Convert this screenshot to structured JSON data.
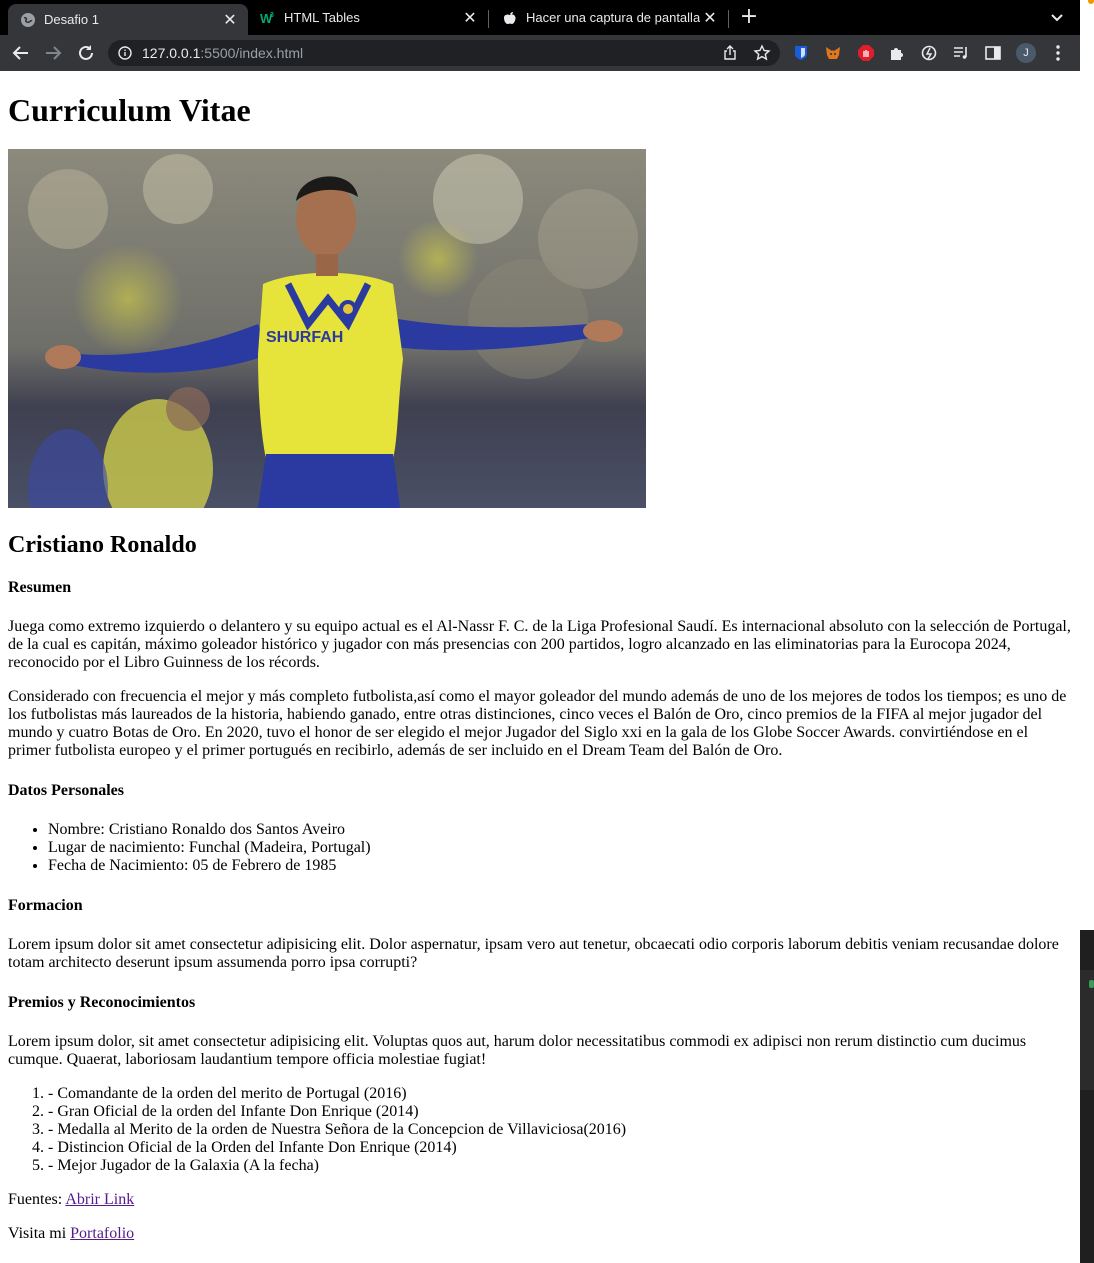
{
  "browser": {
    "tabs": [
      {
        "title": "Desafio 1",
        "close": "✕",
        "active": true
      },
      {
        "title": "HTML Tables",
        "close": "✕",
        "active": false
      },
      {
        "title": "Hacer una captura de pantalla",
        "close": "✕",
        "active": false
      }
    ],
    "new_tab": "+",
    "url_host": "127.0.0.1",
    "url_rest": ":5500/index.html",
    "profile_initial": "J"
  },
  "page": {
    "title": "Curriculum Vitae",
    "photo_logo": "SHURFAH",
    "name": "Cristiano Ronaldo",
    "summary_heading": "Resumen",
    "summary_p1": "Juega como extremo izquierdo o delantero y su equipo actual es el Al-Nassr F. C. de la Liga Profesional Saudí. Es internacional absoluto con la selección de Portugal, de la cual es capitán, máximo goleador histórico y jugador con más presencias con 200 partidos, logro alcanzado en las eliminatorias para la Eurocopa 2024, reconocido por el Libro Guinness de los récords.",
    "summary_p2": "Considerado con frecuencia el mejor y más completo futbolista,así como el mayor goleador del mundo además de uno de los mejores de todos los tiempos; es uno de los futbolistas más laureados de la historia, habiendo ganado, entre otras distinciones, cinco veces el Balón de Oro, cinco premios de la FIFA al mejor jugador del mundo y cuatro Botas de Oro. En 2020, tuvo el honor de ser elegido el mejor Jugador del Siglo xxi en la gala de los Globe Soccer Awards. convirtiéndose en el primer futbolista europeo y el primer portugués en recibirlo, además de ser incluido en el Dream Team del Balón de Oro.",
    "personal_heading": "Datos Personales",
    "personal_items": [
      "Nombre: Cristiano Ronaldo dos Santos Aveiro",
      "Lugar de nacimiento: Funchal (Madeira, Portugal)",
      "Fecha de Nacimiento: 05 de Febrero de 1985"
    ],
    "education_heading": "Formacion",
    "education_text": "Lorem ipsum dolor sit amet consectetur adipisicing elit. Dolor aspernatur, ipsam vero aut tenetur, obcaecati odio corporis laborum debitis veniam recusandae dolore totam architecto deserunt ipsum assumenda porro ipsa corrupti?",
    "awards_heading": "Premios y Reconocimientos",
    "awards_text": "Lorem ipsum dolor, sit amet consectetur adipisicing elit. Voluptas quos aut, harum dolor necessitatibus commodi ex adipisci non rerum distinctio cum ducimus cumque. Quaerat, laboriosam laudantium tempore officia molestiae fugiat!",
    "awards_items": [
      "- Comandante de la orden del merito de Portugal (2016)",
      "- Gran Oficial de la orden del Infante Don Enrique (2014)",
      "- Medalla al Merito de la orden de Nuestra Señora de la Concepcion de Villaviciosa(2016)",
      "- Distincion Oficial de la Orden del Infante Don Enrique (2014)",
      "- Mejor Jugador de la Galaxia (A la fecha)"
    ],
    "sources_label": "Fuentes: ",
    "sources_link": "Abrir Link",
    "visit_label": "Visita mi ",
    "visit_link": "Portafolio"
  },
  "colors": {
    "tabbar": "#000000",
    "toolbar": "#35363a",
    "omnibox": "#202124",
    "link": "#551a8b",
    "jersey_yellow": "#e6e43a",
    "jersey_blue": "#2a3aa0"
  }
}
